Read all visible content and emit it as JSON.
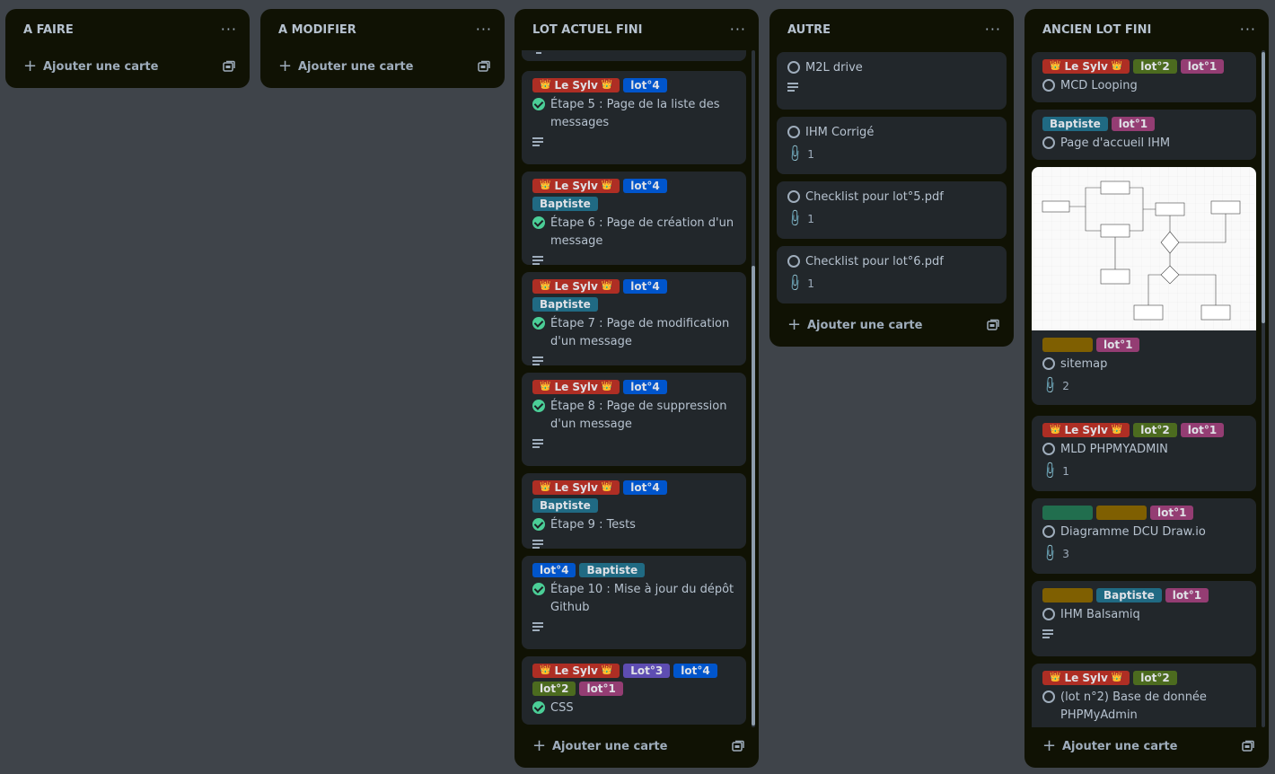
{
  "colors": {
    "red": "#ae2e24",
    "blue": "#0055cc",
    "teal": "#206a83",
    "green": "#4c6b1f",
    "magenta": "#943d73",
    "purple": "#5e4db2",
    "yellow": "#7f5f01",
    "darkgreen": "#216e4e"
  },
  "board": {
    "lists": [
      {
        "title": "A FAIRE",
        "menu": "···",
        "add": "Ajouter une carte"
      },
      {
        "title": "A MODIFIER",
        "menu": "···",
        "add": "Ajouter une carte"
      },
      {
        "title": "LOT ACTUEL FINI",
        "menu": "···",
        "add": "Ajouter une carte"
      },
      {
        "title": "AUTRE",
        "menu": "···",
        "add": "Ajouter une carte"
      },
      {
        "title": "ANCIEN LOT FINI",
        "menu": "···",
        "add": "Ajouter une carte"
      }
    ]
  },
  "labels": {
    "sylv": "Le Sylv",
    "crown": "👑",
    "lot4": "lot°4",
    "lot3": "Lot°3",
    "lot2": "lot°2",
    "lot1": "lot°1",
    "baptiste": "Baptiste"
  },
  "lot_actuel": {
    "cards": [
      {
        "title": "Étape 5 : Page de la liste des messages"
      },
      {
        "title": "Étape 6 : Page de création d'un message"
      },
      {
        "title": "Étape 7 : Page de modification d'un message"
      },
      {
        "title": "Étape 8 : Page de suppression d'un message"
      },
      {
        "title": "Étape 9 : Tests"
      },
      {
        "title": "Étape 10 : Mise à jour du dépôt Github"
      },
      {
        "title": "CSS"
      }
    ]
  },
  "autre": {
    "cards": [
      {
        "title": "M2L drive"
      },
      {
        "title": "IHM Corrigé",
        "attachments": "1"
      },
      {
        "title": "Checklist pour lot°5.pdf",
        "attachments": "1"
      },
      {
        "title": "Checklist pour lot°6.pdf",
        "attachments": "1"
      }
    ]
  },
  "ancien": {
    "cards": [
      {
        "title": "MCD Looping"
      },
      {
        "title": "Page d'accueil IHM"
      },
      {
        "title": "sitemap",
        "attachments": "2"
      },
      {
        "title": "MLD PHPMYADMIN",
        "attachments": "1"
      },
      {
        "title": "Diagramme DCU Draw.io",
        "attachments": "3"
      },
      {
        "title": "IHM Balsamiq"
      },
      {
        "title": "(lot n°2) Base de donnée PHPMyAdmin"
      }
    ]
  }
}
